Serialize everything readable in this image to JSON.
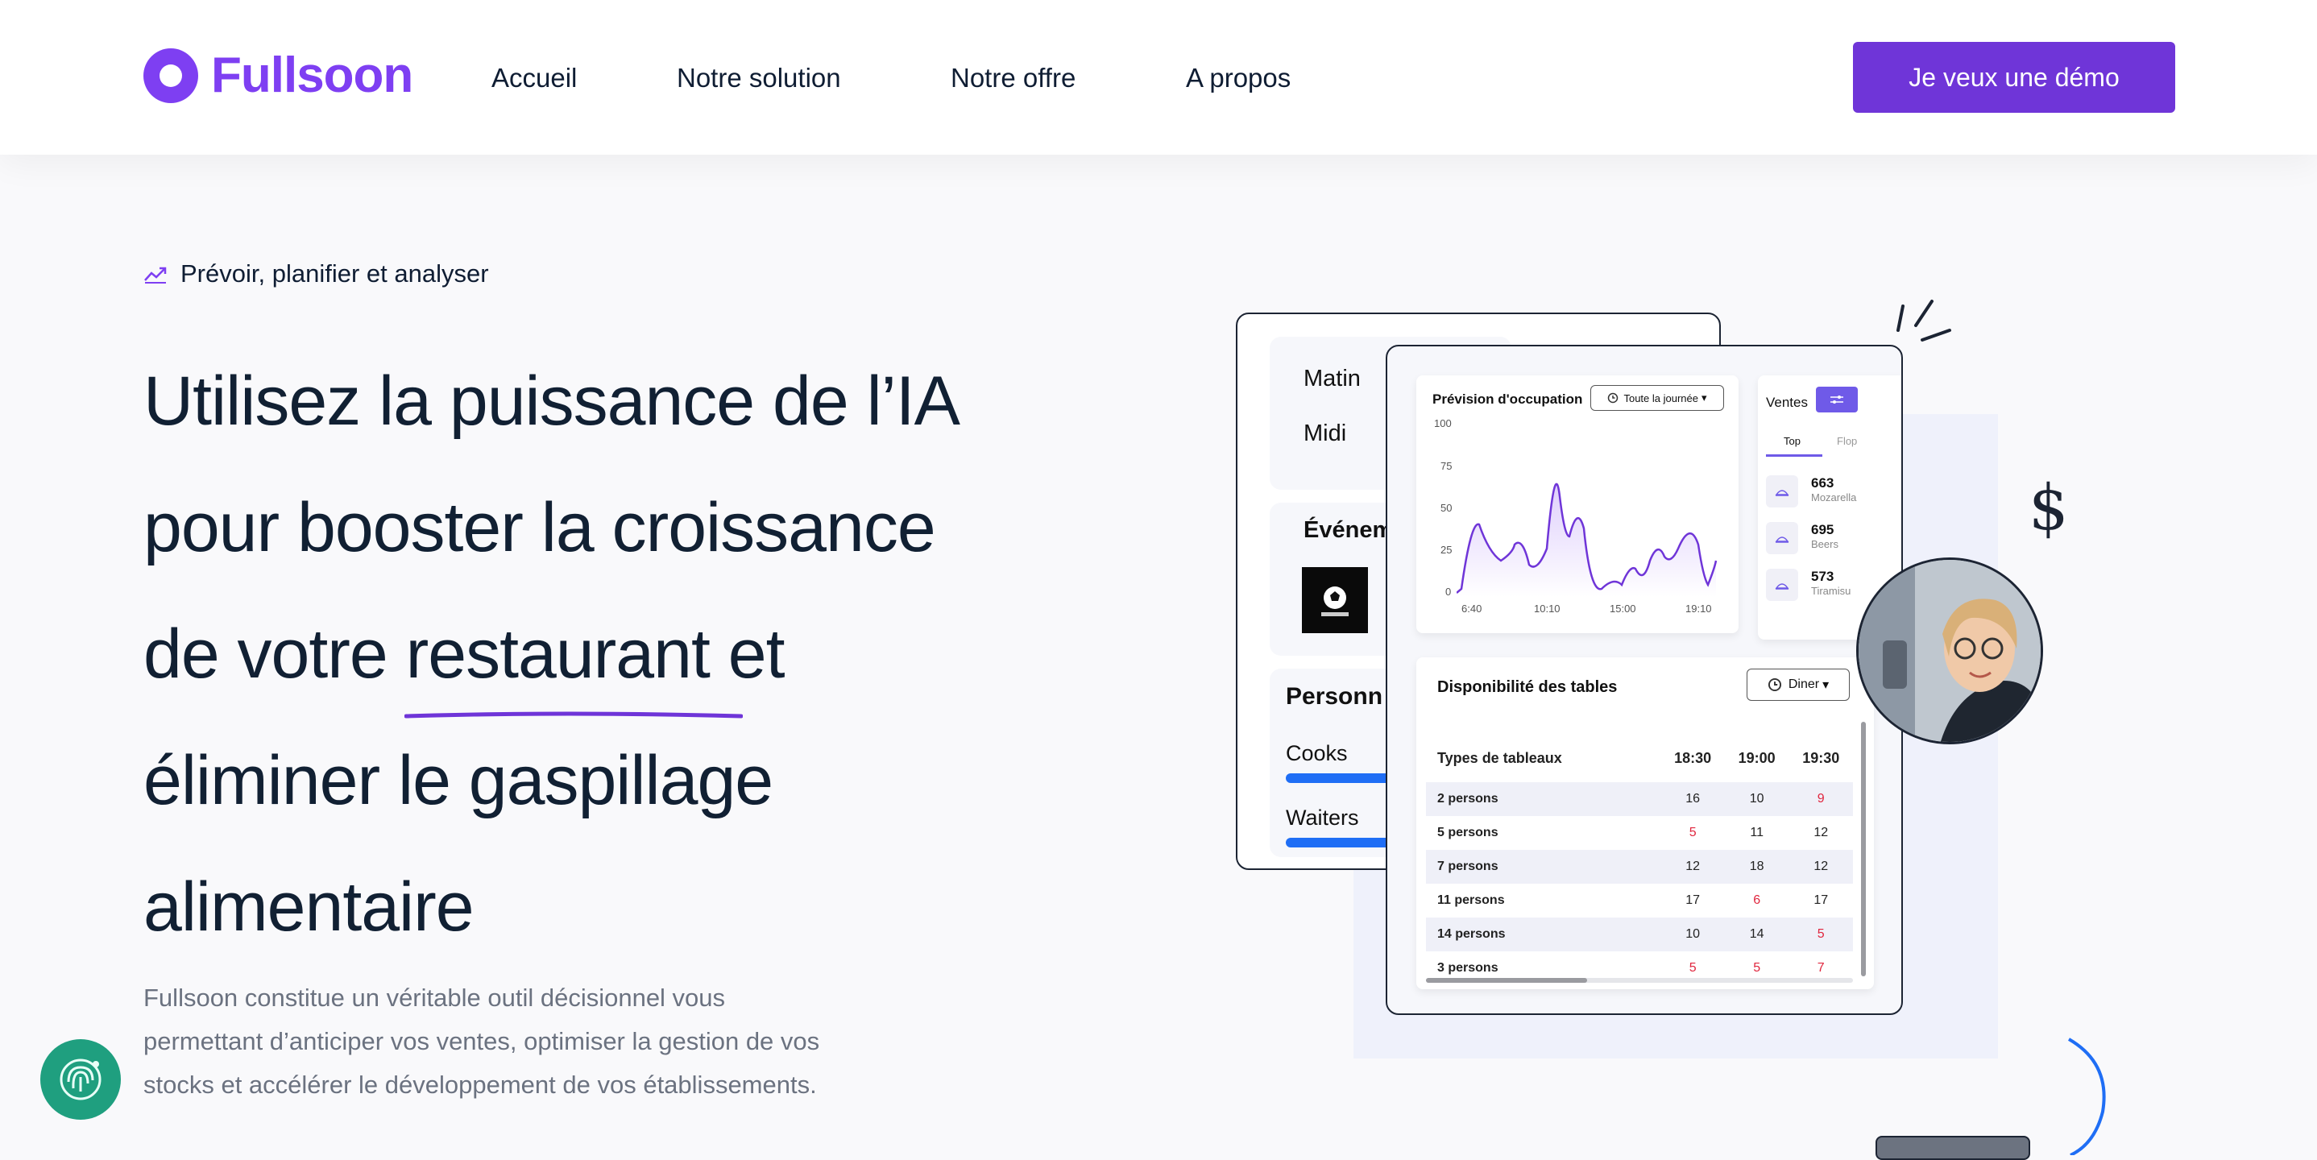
{
  "header": {
    "logo_text": "Fullsoon",
    "nav": [
      "Accueil",
      "Notre solution",
      "Notre offre",
      "A propos"
    ],
    "cta": "Je veux une démo"
  },
  "hero": {
    "eyebrow": "Prévoir, planifier et analyser",
    "headline": {
      "line1": "Utilisez la puissance de l’IA",
      "line2": "pour booster la croissance",
      "line3_pre": "de votre ",
      "line3_underline": "restaurant",
      "line3_post": " et",
      "line4": "éliminer le gaspillage",
      "line5": "alimentaire"
    },
    "description": "Fullsoon constitue un véritable outil décisionnel vous permettant d’anticiper vos ventes, optimiser la gestion de vos stocks et accélérer le développement de vos établissements."
  },
  "back_card": {
    "matin": "Matin",
    "midi": "Midi",
    "events": "Événem",
    "personnel": "Personn",
    "cooks": "Cooks",
    "waiters": "Waiters",
    "cooks_level": 0.9,
    "waiters_level": 0.9
  },
  "occupation": {
    "title": "Prévision d'occupation",
    "filter": "Toute la journée",
    "y_ticks": [
      "100",
      "75",
      "50",
      "25",
      "0"
    ],
    "x_ticks": [
      "6:40",
      "10:10",
      "15:00",
      "19:10"
    ]
  },
  "sales": {
    "title": "Ventes",
    "tab_top": "Top",
    "tab_flop": "Flop",
    "items": [
      {
        "value": "663",
        "name": "Mozarella"
      },
      {
        "value": "695",
        "name": "Beers"
      },
      {
        "value": "573",
        "name": "Tiramisu"
      }
    ]
  },
  "tables": {
    "title": "Disponibilité des tables",
    "filter": "Diner",
    "headers": [
      "Types de tableaux",
      "18:30",
      "19:00",
      "19:30"
    ],
    "rows": [
      {
        "label": "2 persons",
        "values": [
          "16",
          "10",
          "9"
        ],
        "red": [
          false,
          false,
          true
        ]
      },
      {
        "label": "5 persons",
        "values": [
          "5",
          "11",
          "12"
        ],
        "red": [
          true,
          false,
          false
        ]
      },
      {
        "label": "7 persons",
        "values": [
          "12",
          "18",
          "12"
        ],
        "red": [
          false,
          false,
          false
        ]
      },
      {
        "label": "11 persons",
        "values": [
          "17",
          "6",
          "17"
        ],
        "red": [
          false,
          true,
          false
        ]
      },
      {
        "label": "14 persons",
        "values": [
          "10",
          "14",
          "5"
        ],
        "red": [
          false,
          false,
          true
        ]
      },
      {
        "label": "3 persons",
        "values": [
          "5",
          "5",
          "7"
        ],
        "red": [
          true,
          true,
          true
        ]
      }
    ]
  },
  "decor": {
    "dollar": "$"
  },
  "colors": {
    "brand": "#7e3ff2",
    "cta": "#6f35d8",
    "text": "#0f1d33",
    "bar": "#1f6ef5",
    "alert": "#e0263e",
    "chat": "#1f9f7f"
  }
}
